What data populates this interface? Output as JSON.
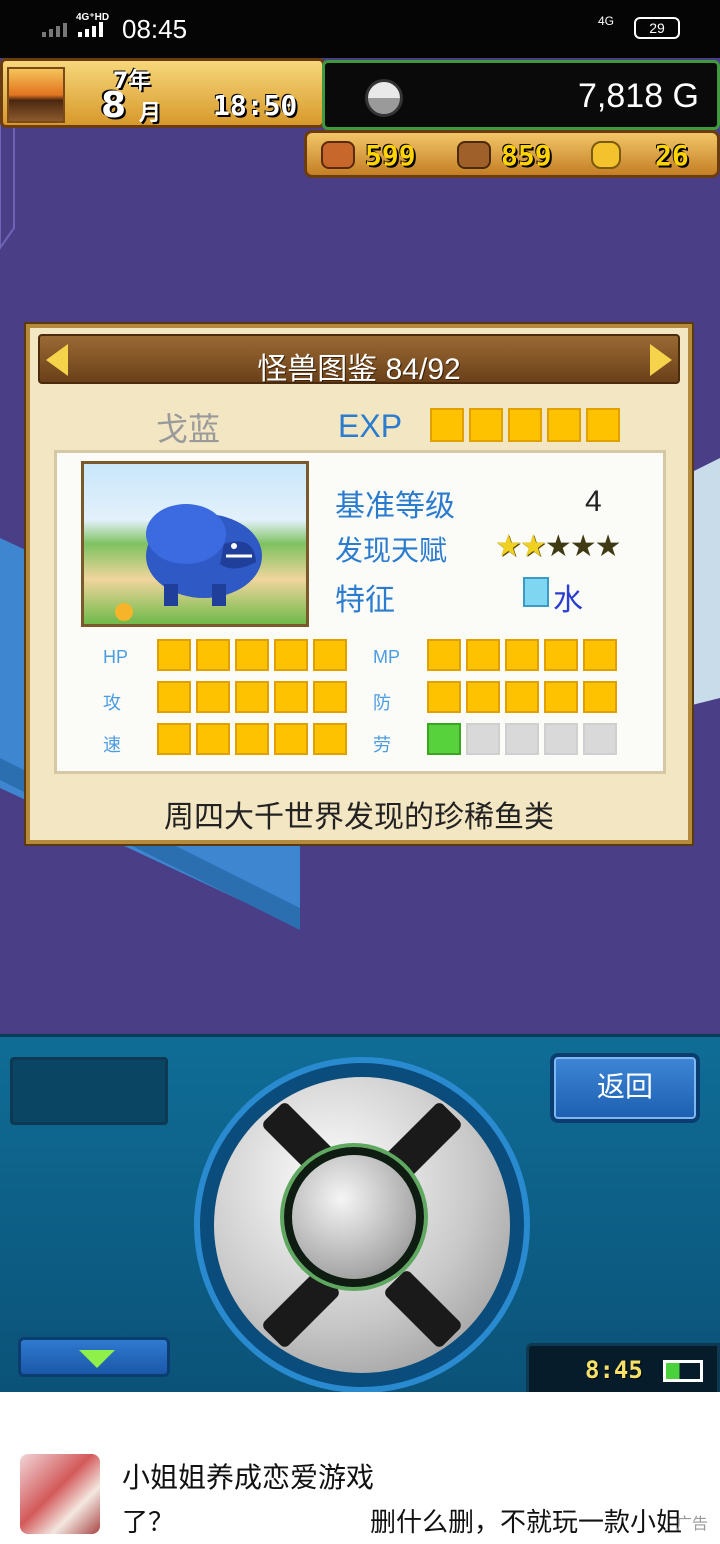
{
  "status_bar": {
    "network_top": "4G⁺HD",
    "time": "08:45",
    "network_right": "4G",
    "battery": "29"
  },
  "hud": {
    "year": "7年",
    "month": "8",
    "month_unit": "月",
    "clock": "18:50",
    "gold": "7,818 G",
    "resources": [
      {
        "icon": "meat-icon",
        "value": "599"
      },
      {
        "icon": "wood-icon",
        "value": "859"
      },
      {
        "icon": "coin-icon",
        "value": "26"
      }
    ]
  },
  "dex": {
    "title": "怪兽图鉴 84/92",
    "monster_name": "戈蓝",
    "exp_label": "EXP",
    "exp_filled": 5,
    "exp_total": 5,
    "base_level_label": "基准等级",
    "base_level_value": "4",
    "talent_label": "发现天赋",
    "talent_stars": 2,
    "talent_max": 5,
    "trait_label": "特征",
    "trait_value": "水",
    "stats": [
      {
        "label": "HP",
        "filled": 5
      },
      {
        "label": "MP",
        "filled": 5
      },
      {
        "label": "攻",
        "filled": 5
      },
      {
        "label": "防",
        "filled": 5
      },
      {
        "label": "速",
        "filled": 5
      },
      {
        "label": "劳",
        "filled": 1
      }
    ],
    "description": "周四大千世界发现的珍稀鱼类"
  },
  "controller": {
    "back_label": "返回",
    "mini_clock": "8:45"
  },
  "ad": {
    "title": "小姐姐养成恋爱游戏",
    "sub1": "了？",
    "sub2": "删什么删，不就玩一款小姐",
    "tag": "广告"
  },
  "colors": {
    "accent_blue": "#2b7ccf",
    "bar_yellow": "#ffc200",
    "bar_green": "#58d23c",
    "game_bg": "#4a3f87"
  }
}
